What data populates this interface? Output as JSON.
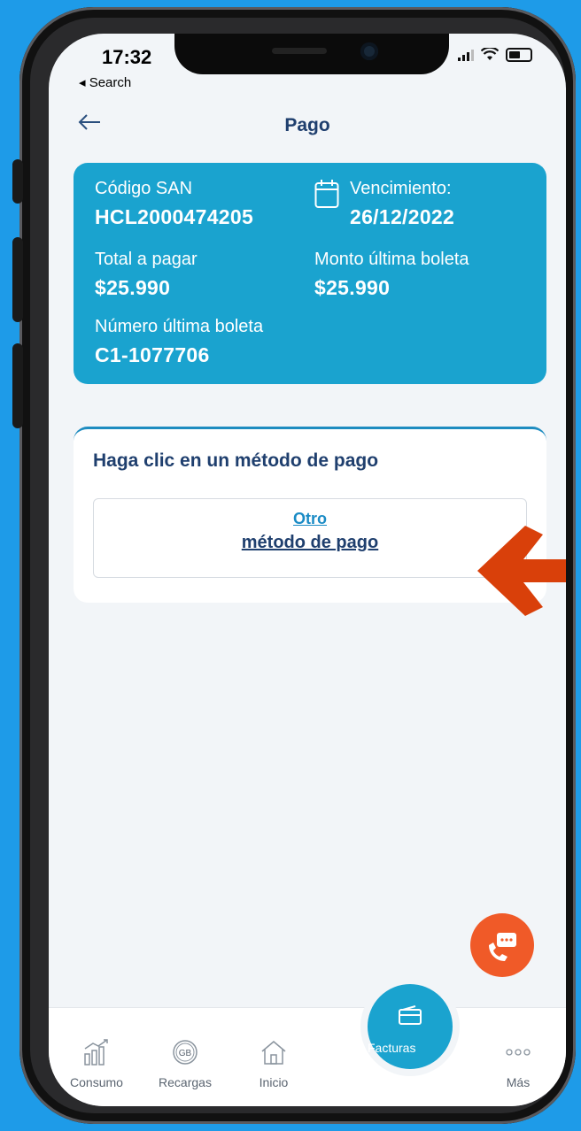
{
  "status_bar": {
    "time": "17:32",
    "back_app": "◂ Search"
  },
  "header": {
    "title": "Pago",
    "back_icon": "arrow-left-icon"
  },
  "account": {
    "code_label": "Código SAN",
    "code_value": "HCL2000474205",
    "due_label": "Vencimiento:",
    "due_value": "26/12/2022",
    "total_label": "Total a pagar",
    "total_value": "$25.990",
    "last_amount_label": "Monto última boleta",
    "last_amount_value": "$25.990",
    "invoice_label": "Número última boleta",
    "invoice_value": "C1-1077706"
  },
  "payment": {
    "title": "Haga clic en un método de pago",
    "option_line1": "Otro",
    "option_line2": "método de pago"
  },
  "tabs": [
    {
      "label": "Consumo",
      "icon": "chart-icon"
    },
    {
      "label": "Recargas",
      "icon": "gb-icon"
    },
    {
      "label": "Inicio",
      "icon": "home-icon"
    },
    {
      "label": "Facturas",
      "icon": "card-icon"
    },
    {
      "label": "Más",
      "icon": "more-icon"
    }
  ],
  "colors": {
    "background": "#1e9be8",
    "card": "#1aa3cf",
    "title": "#1f3f6e",
    "accent": "#f05a28",
    "arrow": "#d9400a"
  }
}
